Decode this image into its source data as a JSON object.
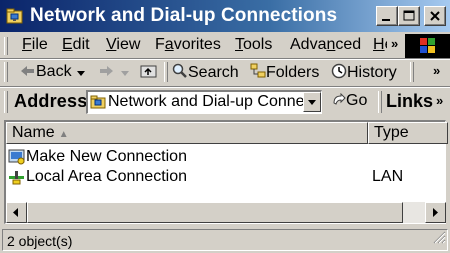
{
  "window": {
    "title": "Network and Dial-up Connections"
  },
  "title_buttons": {
    "minimize_icon": "minimize-icon",
    "maximize_icon": "maximize-icon",
    "close_icon": "close-icon"
  },
  "menu": {
    "items": [
      "File",
      "Edit",
      "View",
      "Favorites",
      "Tools",
      "Advanced",
      "He"
    ],
    "underline_chars": [
      "F",
      "E",
      "V",
      "a",
      "T",
      "n",
      "H"
    ],
    "overflow": "»"
  },
  "toolbar": {
    "back_label": "Back",
    "search_label": "Search",
    "folders_label": "Folders",
    "history_label": "History",
    "overflow": "»"
  },
  "address": {
    "label": "Address",
    "value": "Network and Dial-up Conne",
    "go_label": "Go",
    "links_label": "Links",
    "links_overflow": "»"
  },
  "list": {
    "columns": [
      "Name",
      "Type"
    ],
    "rows": [
      {
        "name": "Make New Connection",
        "type": "",
        "icon": "make-new-connection-icon"
      },
      {
        "name": "Local Area Connection",
        "type": "LAN",
        "icon": "lan-connection-icon"
      }
    ]
  },
  "status": {
    "text": "2 object(s)"
  },
  "colors": {
    "title_gradient_start": "#0a246a",
    "title_gradient_end": "#a6caf0",
    "face": "#d4d0c8"
  }
}
